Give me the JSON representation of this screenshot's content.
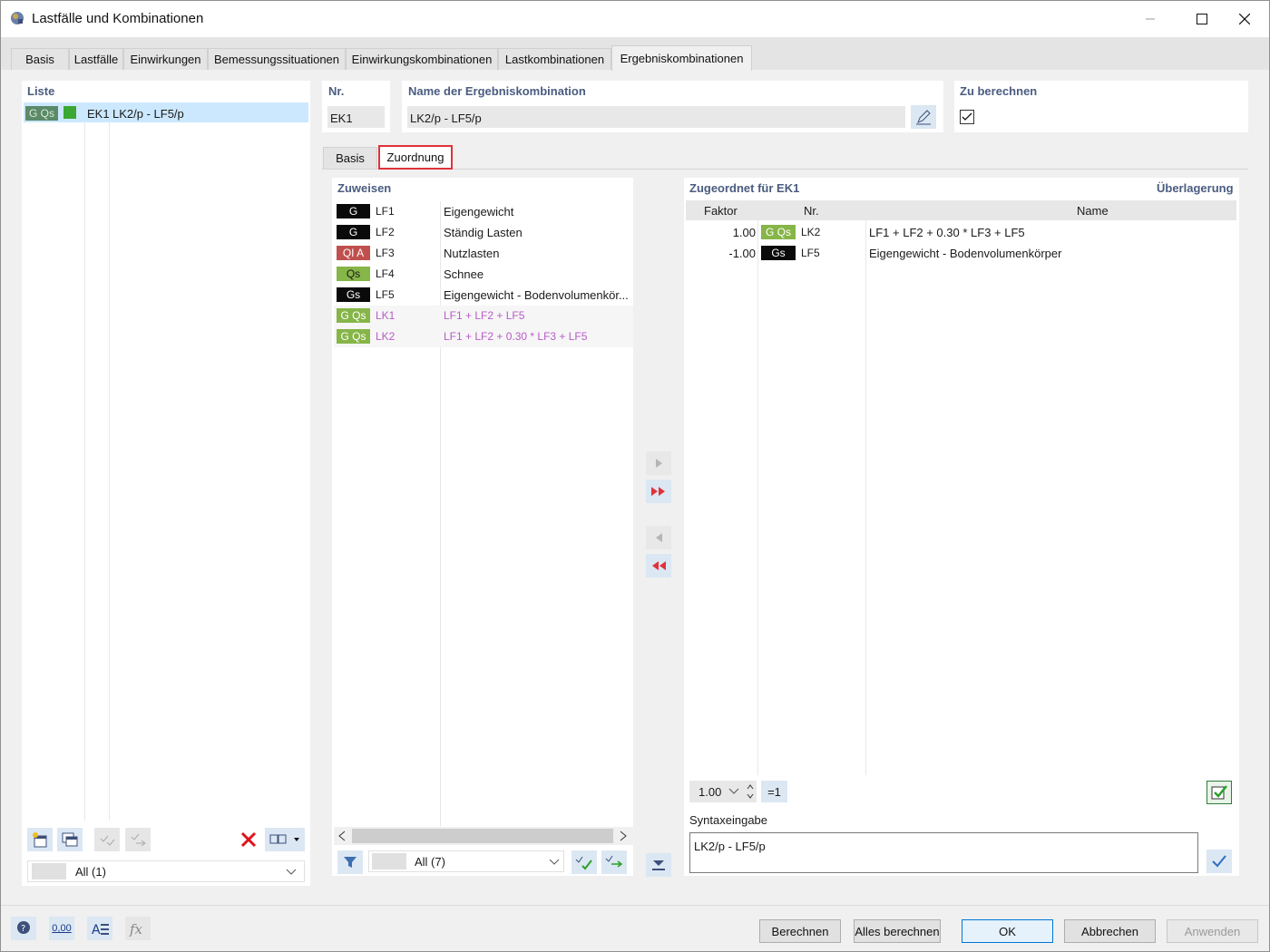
{
  "window": {
    "title": "Lastfälle und Kombinationen"
  },
  "main_tabs": [
    "Basis",
    "Lastfälle",
    "Einwirkungen",
    "Bemessungssituationen",
    "Einwirkungskombinationen",
    "Lastkombinationen",
    "Ergebniskombinationen"
  ],
  "liste": {
    "title": "Liste",
    "items": [
      {
        "badge": "G Qs",
        "id": "EK1",
        "name": "LK2/p - LF5/p"
      }
    ],
    "filter": "All (1)"
  },
  "header": {
    "nr_label": "Nr.",
    "nr_value": "EK1",
    "name_label": "Name der Ergebniskombination",
    "name_value": "LK2/p - LF5/p",
    "calc_label": "Zu berechnen",
    "calc_checked": true
  },
  "sub_tabs": [
    "Basis",
    "Zuordnung"
  ],
  "zuweisen": {
    "title": "Zuweisen",
    "items": [
      {
        "badge": "G",
        "badge_color": "#0a0a0a",
        "id": "LF1",
        "name": "Eigengewicht",
        "combo": false
      },
      {
        "badge": "G",
        "badge_color": "#0a0a0a",
        "id": "LF2",
        "name": "Ständig Lasten",
        "combo": false
      },
      {
        "badge": "QI A",
        "badge_color": "#c0504d",
        "id": "LF3",
        "name": "Nutzlasten",
        "combo": false
      },
      {
        "badge": "Qs",
        "badge_color": "#86b548",
        "id": "LF4",
        "name": "Schnee",
        "combo": false
      },
      {
        "badge": "Gs",
        "badge_color": "#0a0a0a",
        "id": "LF5",
        "name": "Eigengewicht - Bodenvolumenkör...",
        "combo": false
      },
      {
        "badge": "G Qs",
        "badge_color": "#86b548",
        "id": "LK1",
        "name": "LF1 + LF2 + LF5",
        "combo": true
      },
      {
        "badge": "G Qs",
        "badge_color": "#86b548",
        "id": "LK2",
        "name": "LF1 + LF2 + 0.30 * LF3 + LF5",
        "combo": true
      }
    ],
    "filter": "All (7)"
  },
  "zugeordnet": {
    "title": "Zugeordnet für EK1",
    "overlay_label": "Überlagerung",
    "columns": [
      "Faktor",
      "Nr.",
      "Name"
    ],
    "rows": [
      {
        "factor": "1.00",
        "badge": "G Qs",
        "badge_color": "#86b548",
        "id": "LK2",
        "name": "LF1 + LF2 + 0.30 * LF3 + LF5"
      },
      {
        "factor": "-1.00",
        "badge": "Gs",
        "badge_color": "#0a0a0a",
        "id": "LF5",
        "name": "Eigengewicht - Bodenvolumenkörper"
      }
    ],
    "factor_value": "1.00",
    "eq_one": "=1",
    "syntax_label": "Syntaxeingabe",
    "syntax_value": "LK2/p - LF5/p"
  },
  "footer": {
    "buttons": [
      "Berechnen",
      "Alles berechnen",
      "OK",
      "Abbrechen",
      "Anwenden"
    ],
    "zero_label": "0,00"
  },
  "colors": {
    "accent": "#4a5c80",
    "highlight_tab": "#e0323a",
    "selection": "#cce8ff",
    "combo_text": "#b85cc8"
  }
}
